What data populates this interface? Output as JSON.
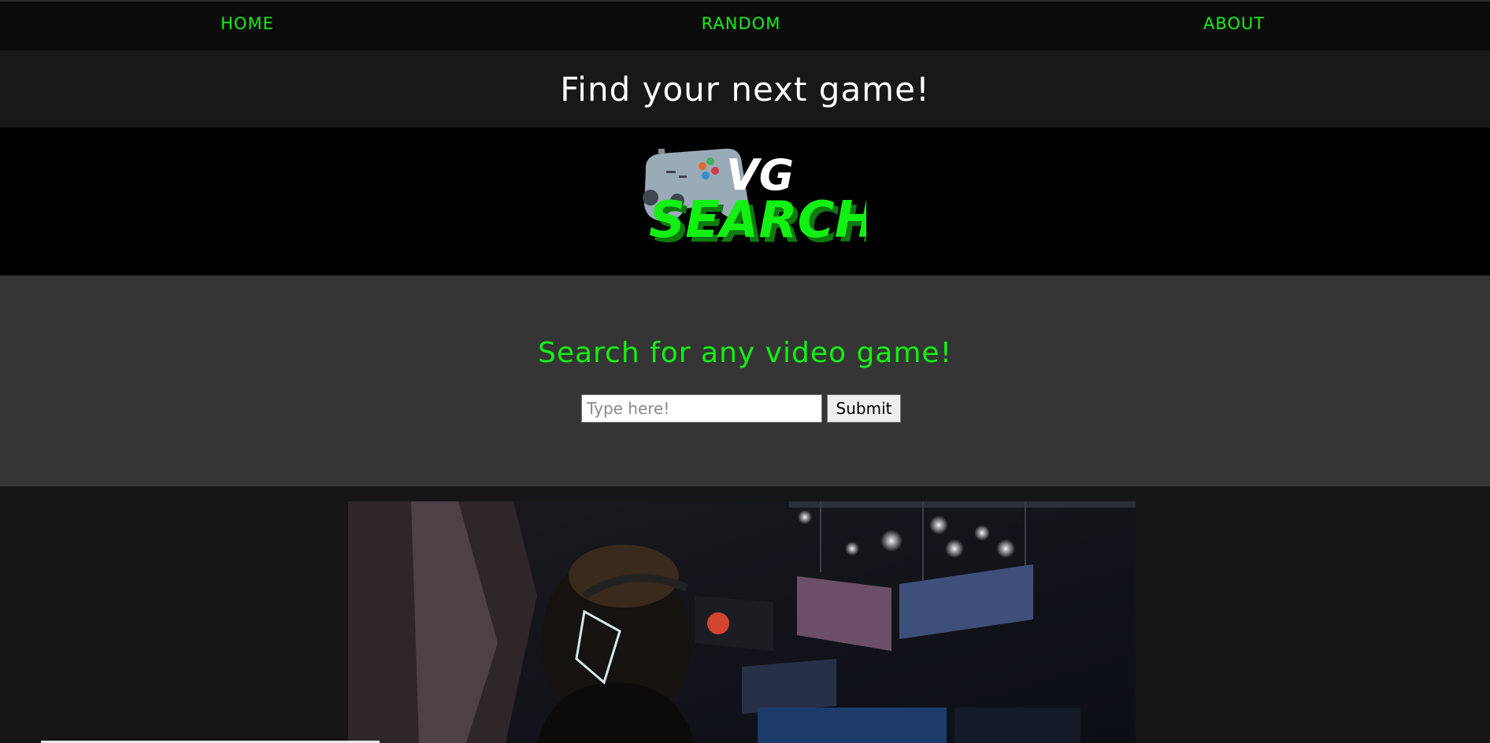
{
  "nav": {
    "items": [
      {
        "label": "HOME"
      },
      {
        "label": "RANDOM"
      },
      {
        "label": "ABOUT"
      }
    ]
  },
  "hero": {
    "title": "Find your next game!"
  },
  "logo": {
    "top_text": "VG",
    "main_text": "SEARCH"
  },
  "search": {
    "heading": "Search for any video game!",
    "placeholder": "Type here!",
    "value": "",
    "submit_label": "Submit"
  },
  "photo": {
    "subject": "esports-player-photo"
  },
  "colors": {
    "accent": "#13f013",
    "nav_bg": "#0b0b0b",
    "title_band_bg": "#181818",
    "search_band_bg": "#353535"
  }
}
